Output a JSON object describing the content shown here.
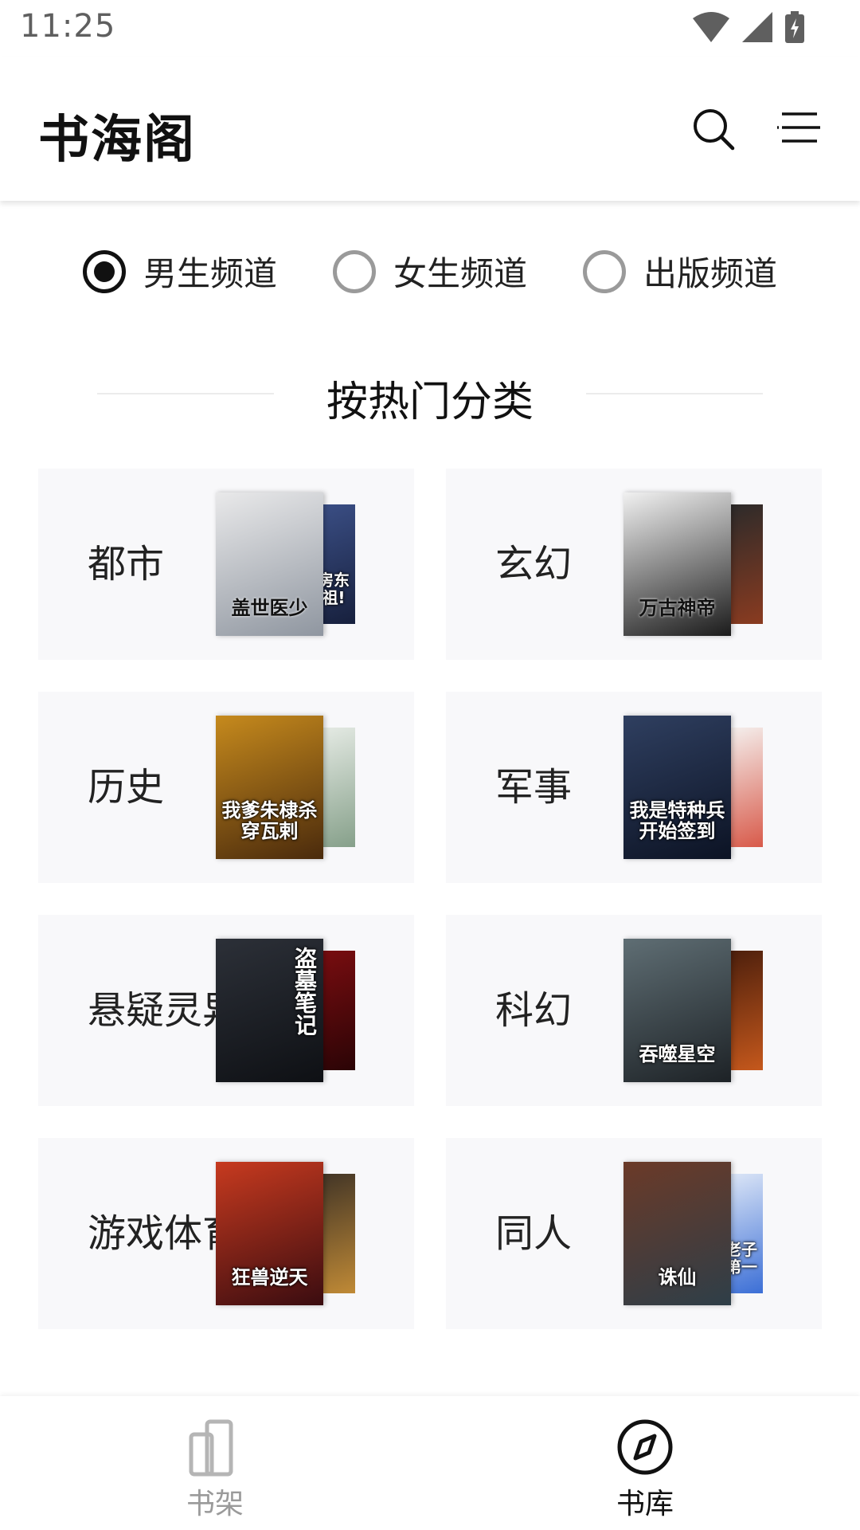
{
  "status_bar": {
    "time": "11:25"
  },
  "header": {
    "title": "书海阁",
    "icons": [
      "search-icon",
      "menu-icon"
    ]
  },
  "channels": [
    {
      "label": "男生频道",
      "checked": true
    },
    {
      "label": "女生频道",
      "checked": false
    },
    {
      "label": "出版频道",
      "checked": false
    }
  ],
  "section": {
    "title": "按热门分类"
  },
  "categories": [
    {
      "label": "都市",
      "cover_front": {
        "title": "盖世医少",
        "colors": [
          "#e9e9ea",
          "#8f96a0"
        ],
        "text_color": "dark"
      },
      "cover_back": {
        "title": "房东祖!",
        "colors": [
          "#3b4f86",
          "#17203d"
        ]
      }
    },
    {
      "label": "玄幻",
      "cover_front": {
        "title": "万古神帝",
        "colors": [
          "#f1f1f1",
          "#1b1b1b"
        ],
        "text_color": "dark"
      },
      "cover_back": {
        "title": "",
        "colors": [
          "#2a2a2a",
          "#8a3b20"
        ]
      }
    },
    {
      "label": "历史",
      "cover_front": {
        "title": "我爹朱棣杀穿瓦剌",
        "colors": [
          "#c68a1d",
          "#4a2a0c"
        ]
      },
      "cover_back": {
        "title": "",
        "colors": [
          "#e7ece6",
          "#86a08a"
        ]
      }
    },
    {
      "label": "军事",
      "cover_front": {
        "title": "我是特种兵开始签到",
        "colors": [
          "#2f3f60",
          "#0c1324"
        ]
      },
      "cover_back": {
        "title": "",
        "colors": [
          "#f5f3f1",
          "#d85a4a"
        ]
      }
    },
    {
      "label": "悬疑灵异",
      "cover_front": {
        "title": "盗墓笔记",
        "colors": [
          "#2c3038",
          "#0e1014"
        ],
        "vertical": true
      },
      "cover_back": {
        "title": "",
        "colors": [
          "#7a0d10",
          "#2b0406"
        ]
      }
    },
    {
      "label": "科幻",
      "cover_front": {
        "title": "吞噬星空",
        "colors": [
          "#5f6e74",
          "#1d2226"
        ]
      },
      "cover_back": {
        "title": "",
        "colors": [
          "#4a1e0c",
          "#c5581c"
        ]
      }
    },
    {
      "label": "游戏体育",
      "cover_front": {
        "title": "狂兽逆天",
        "colors": [
          "#c73a1f",
          "#3a0c10"
        ]
      },
      "cover_back": {
        "title": "",
        "colors": [
          "#3f3326",
          "#c08a36"
        ]
      }
    },
    {
      "label": "同人",
      "cover_front": {
        "title": "诛仙",
        "colors": [
          "#6b3a28",
          "#2e3e48"
        ]
      },
      "cover_back": {
        "title": "老子第一",
        "colors": [
          "#dfe8f7",
          "#3c6fd6"
        ]
      }
    }
  ],
  "bottom_nav": [
    {
      "label": "书架",
      "icon": "bookshelf-icon",
      "active": false
    },
    {
      "label": "书库",
      "icon": "compass-icon",
      "active": true
    }
  ],
  "colors": {
    "accent": "#111111",
    "inactive": "#9a9a9a",
    "card_bg": "#f8f8fa"
  }
}
